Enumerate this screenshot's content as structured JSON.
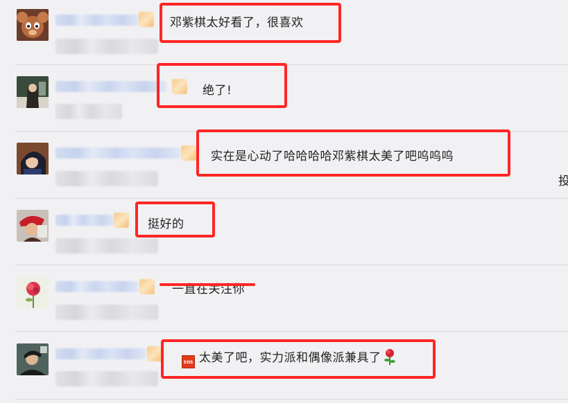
{
  "comments": [
    {
      "text": "邓紫棋太好看了，很喜欢"
    },
    {
      "text": "绝了!"
    },
    {
      "text": "实在是心动了哈哈哈哈邓紫棋太美了吧呜呜呜"
    },
    {
      "text": "挺好的"
    },
    {
      "text": "一直在关注你"
    },
    {
      "text": "太美了吧，实力派和偶像派兼具了",
      "prefix_icon": "sos-emoji-icon",
      "suffix_icon": "rose-emoji-icon",
      "sos_label": "SOS"
    }
  ],
  "side_char": "投",
  "colors": {
    "background": "#f1f1f4",
    "highlight": "#ff2525",
    "divider": "#d9d9de"
  }
}
